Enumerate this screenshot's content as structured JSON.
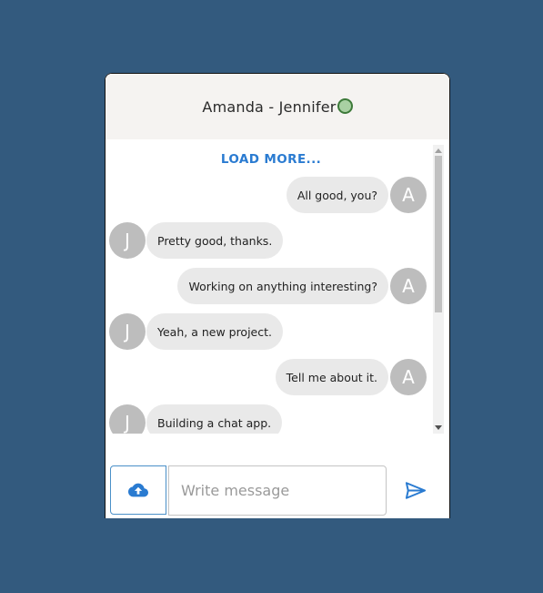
{
  "header": {
    "title": "Amanda - Jennifer",
    "status_color": "#a9d0a3"
  },
  "load_more_label": "LOAD MORE...",
  "messages": [
    {
      "side": "right",
      "avatar": "A",
      "text": "All good, you?"
    },
    {
      "side": "left",
      "avatar": "J",
      "text": "Pretty good, thanks."
    },
    {
      "side": "right",
      "avatar": "A",
      "text": "Working on anything interesting?"
    },
    {
      "side": "left",
      "avatar": "J",
      "text": "Yeah, a new project."
    },
    {
      "side": "right",
      "avatar": "A",
      "text": "Tell me about it."
    },
    {
      "side": "left",
      "avatar": "J",
      "text": "Building a chat app."
    }
  ],
  "composer": {
    "placeholder": "Write message",
    "value": "",
    "upload_icon": "cloud-upload-icon",
    "send_icon": "send-icon"
  },
  "colors": {
    "background": "#335a7e",
    "accent": "#2a7bd1",
    "bubble": "#e9e9e9",
    "avatar": "#bdbdbd"
  }
}
